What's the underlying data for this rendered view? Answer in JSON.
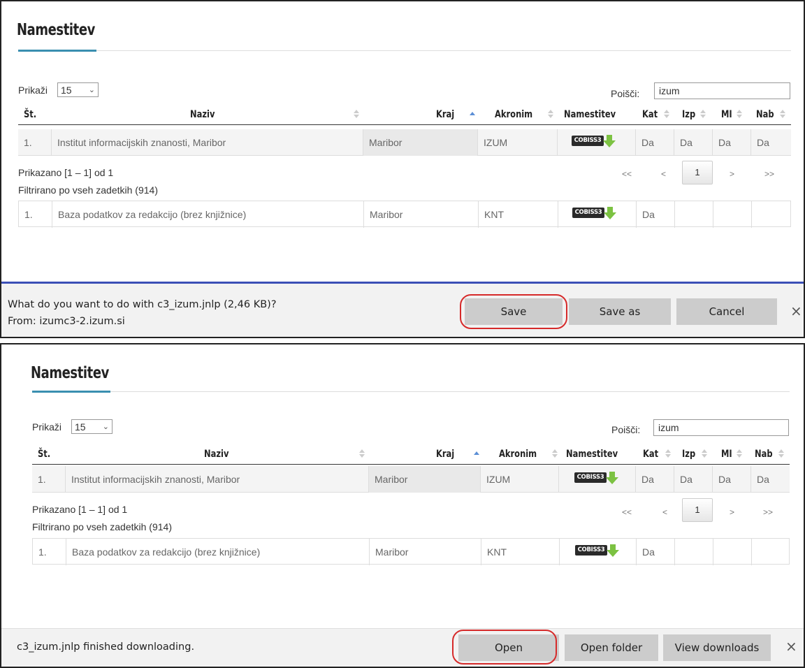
{
  "panels": [
    {
      "title": "Namestitev",
      "show_label": "Prikaži",
      "page_size": "15",
      "search_label": "Poišči:",
      "search_value": "izum",
      "columns": [
        "Št.",
        "Naziv",
        "Kraj",
        "Akronim",
        "Namestitev",
        "Kat",
        "Izp",
        "MI",
        "Nab"
      ],
      "row1": {
        "num": "1.",
        "name": "Institut informacijskih znanosti, Maribor",
        "city": "Maribor",
        "acronym": "IZUM",
        "badge": "COBISS3",
        "kat": "Da",
        "izp": "Da",
        "mi": "Da",
        "nab": "Da"
      },
      "info_shown": "Prikazano [1 – 1] od 1",
      "info_filtered": "Filtrirano po vseh zadetkih (914)",
      "pager": {
        "first": "<<",
        "prev": "<",
        "current": "1",
        "next": ">",
        "last": ">>"
      },
      "row2": {
        "num": "1.",
        "name": "Baza podatkov za redakcijo (brez knjižnice)",
        "city": "Maribor",
        "acronym": "KNT",
        "badge": "COBISS3",
        "kat": "Da",
        "izp": "",
        "mi": "",
        "nab": ""
      },
      "download": {
        "line1": "What do you want to do with c3_izum.jnlp (2,46 KB)?",
        "line2": "From: izumc3-2.izum.si",
        "buttons": [
          "Save",
          "Save as",
          "Cancel"
        ],
        "close": "×"
      }
    },
    {
      "title": "Namestitev",
      "show_label": "Prikaži",
      "page_size": "15",
      "search_label": "Poišči:",
      "search_value": "izum",
      "columns": [
        "Št.",
        "Naziv",
        "Kraj",
        "Akronim",
        "Namestitev",
        "Kat",
        "Izp",
        "MI",
        "Nab"
      ],
      "row1": {
        "num": "1.",
        "name": "Institut informacijskih znanosti, Maribor",
        "city": "Maribor",
        "acronym": "IZUM",
        "badge": "COBISS3",
        "kat": "Da",
        "izp": "Da",
        "mi": "Da",
        "nab": "Da"
      },
      "info_shown": "Prikazano [1 – 1] od 1",
      "info_filtered": "Filtrirano po vseh zadetkih (914)",
      "pager": {
        "first": "<<",
        "prev": "<",
        "current": "1",
        "next": ">",
        "last": ">>"
      },
      "row2": {
        "num": "1.",
        "name": "Baza podatkov za redakcijo (brez knjižnice)",
        "city": "Maribor",
        "acronym": "KNT",
        "badge": "COBISS3",
        "kat": "Da",
        "izp": "",
        "mi": "",
        "nab": ""
      },
      "download": {
        "line1": "c3_izum.jnlp finished downloading.",
        "buttons": [
          "Open",
          "Open folder",
          "View downloads"
        ],
        "close": "×"
      }
    }
  ],
  "colors": {
    "accent_underline": "#3a8fb0",
    "download_bar_border": "#3b4fb6",
    "highlight_ring": "#d62a2a",
    "badge_arrow": "#7cc242"
  }
}
